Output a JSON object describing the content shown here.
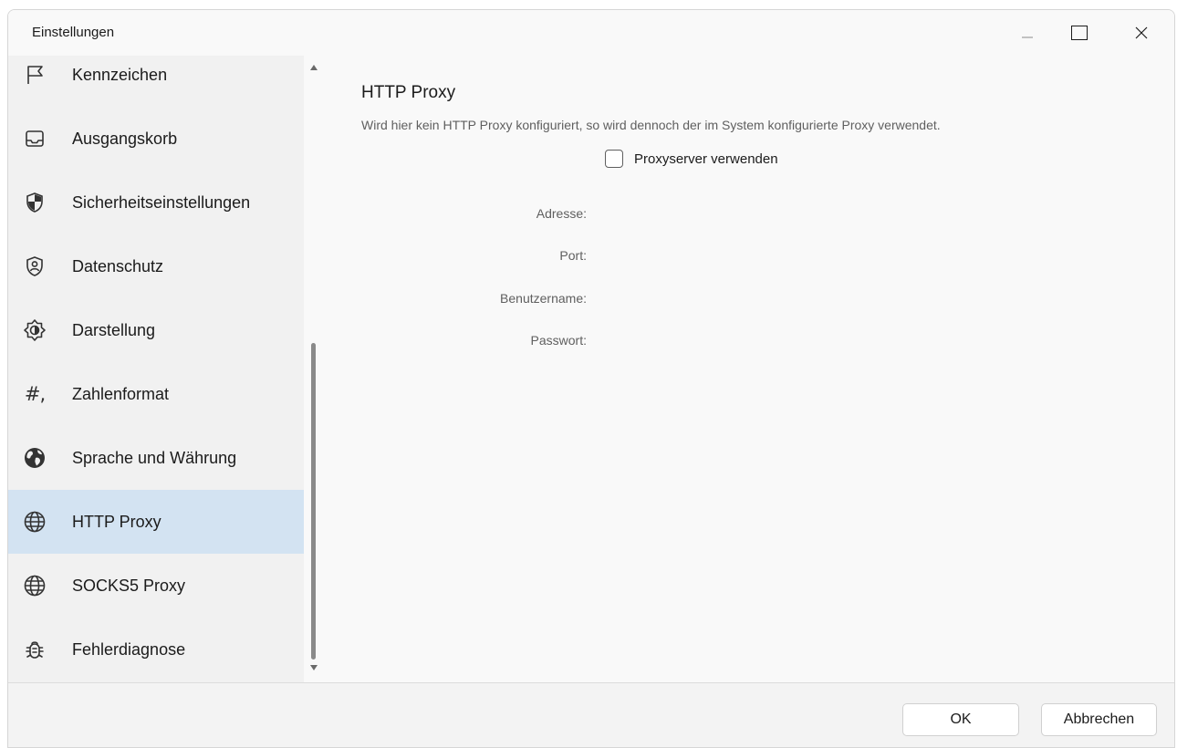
{
  "window": {
    "title": "Einstellungen"
  },
  "sidebar": {
    "items": [
      {
        "label": "Kennzeichen",
        "icon": "flag-icon"
      },
      {
        "label": "Ausgangskorb",
        "icon": "outbox-tray-icon"
      },
      {
        "label": "Sicherheitseinstellungen",
        "icon": "shield-icon"
      },
      {
        "label": "Datenschutz",
        "icon": "privacy-shield-person-icon"
      },
      {
        "label": "Darstellung",
        "icon": "brightness-icon"
      },
      {
        "label": "Zahlenformat",
        "icon": "number-format-icon"
      },
      {
        "label": "Sprache und Währung",
        "icon": "earth-globe-icon"
      },
      {
        "label": "HTTP Proxy",
        "icon": "globe-icon",
        "selected": true
      },
      {
        "label": "SOCKS5 Proxy",
        "icon": "globe-icon"
      },
      {
        "label": "Fehlerdiagnose",
        "icon": "bug-icon"
      }
    ],
    "selected_color": "#d3e3f2"
  },
  "icons": {
    "number_format_glyph": "#,"
  },
  "main": {
    "title": "HTTP Proxy",
    "description": "Wird hier kein HTTP Proxy konfiguriert, so wird dennoch der im System konfigurierte Proxy verwendet.",
    "use_proxy_label": "Proxyserver verwenden",
    "use_proxy_checked": false,
    "fields": {
      "address": {
        "label": "Adresse:",
        "value": ""
      },
      "port": {
        "label": "Port:",
        "value": ""
      },
      "username": {
        "label": "Benutzername:",
        "value": ""
      },
      "password": {
        "label": "Passwort:",
        "value": ""
      }
    }
  },
  "footer": {
    "ok_label": "OK",
    "cancel_label": "Abbrechen"
  }
}
